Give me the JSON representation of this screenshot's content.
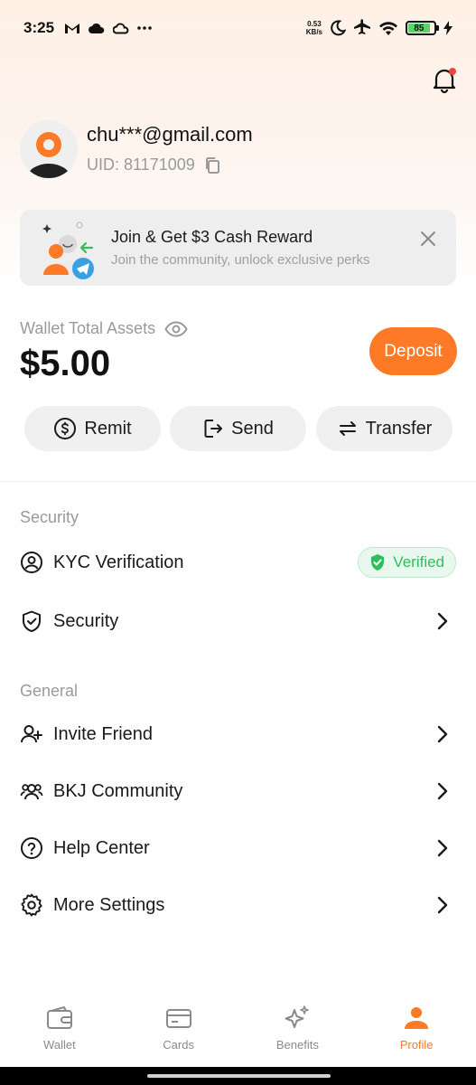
{
  "status_bar": {
    "time": "3:25",
    "net_speed_value": "0.53",
    "net_speed_unit": "KB/s",
    "battery_level": "85",
    "icons": [
      "gmail-icon",
      "cloud-icon",
      "cloud-outline-icon",
      "more-dots-icon",
      "moon-icon",
      "airplane-icon",
      "wifi-icon",
      "battery-icon",
      "charging-icon"
    ]
  },
  "header": {
    "notification_icon": "bell-icon",
    "has_unread": true
  },
  "profile": {
    "email": "chu***@gmail.com",
    "uid": "UID: 81171009",
    "copy_icon": "copy-icon"
  },
  "banner": {
    "title": "Join & Get $3 Cash Reward",
    "subtitle": "Join the community, unlock exclusive perks",
    "close_icon": "close-icon"
  },
  "wallet": {
    "label": "Wallet Total Assets",
    "amount": "$5.00",
    "deposit_label": "Deposit",
    "actions": [
      {
        "label": "Remit",
        "icon": "dollar-cycle-icon"
      },
      {
        "label": "Send",
        "icon": "send-out-icon"
      },
      {
        "label": "Transfer",
        "icon": "transfer-icon"
      }
    ]
  },
  "security_section": {
    "title": "Security",
    "items": [
      {
        "label": "KYC Verification",
        "icon": "user-circle-icon",
        "badge": "Verified"
      },
      {
        "label": "Security",
        "icon": "shield-check-icon"
      }
    ]
  },
  "general_section": {
    "title": "General",
    "items": [
      {
        "label": "Invite Friend",
        "icon": "user-plus-icon"
      },
      {
        "label": "BKJ Community",
        "icon": "users-icon"
      },
      {
        "label": "Help Center",
        "icon": "question-circle-icon"
      },
      {
        "label": "More Settings",
        "icon": "gear-icon"
      }
    ]
  },
  "bottom_nav": {
    "items": [
      {
        "label": "Wallet",
        "icon": "wallet-icon"
      },
      {
        "label": "Cards",
        "icon": "card-icon"
      },
      {
        "label": "Benefits",
        "icon": "sparkle-icon"
      },
      {
        "label": "Profile",
        "icon": "person-icon"
      }
    ],
    "active": "Profile"
  },
  "colors": {
    "accent": "#ff7a26",
    "verified_green": "#2fbf5a",
    "muted_text": "#9a9a9a"
  }
}
